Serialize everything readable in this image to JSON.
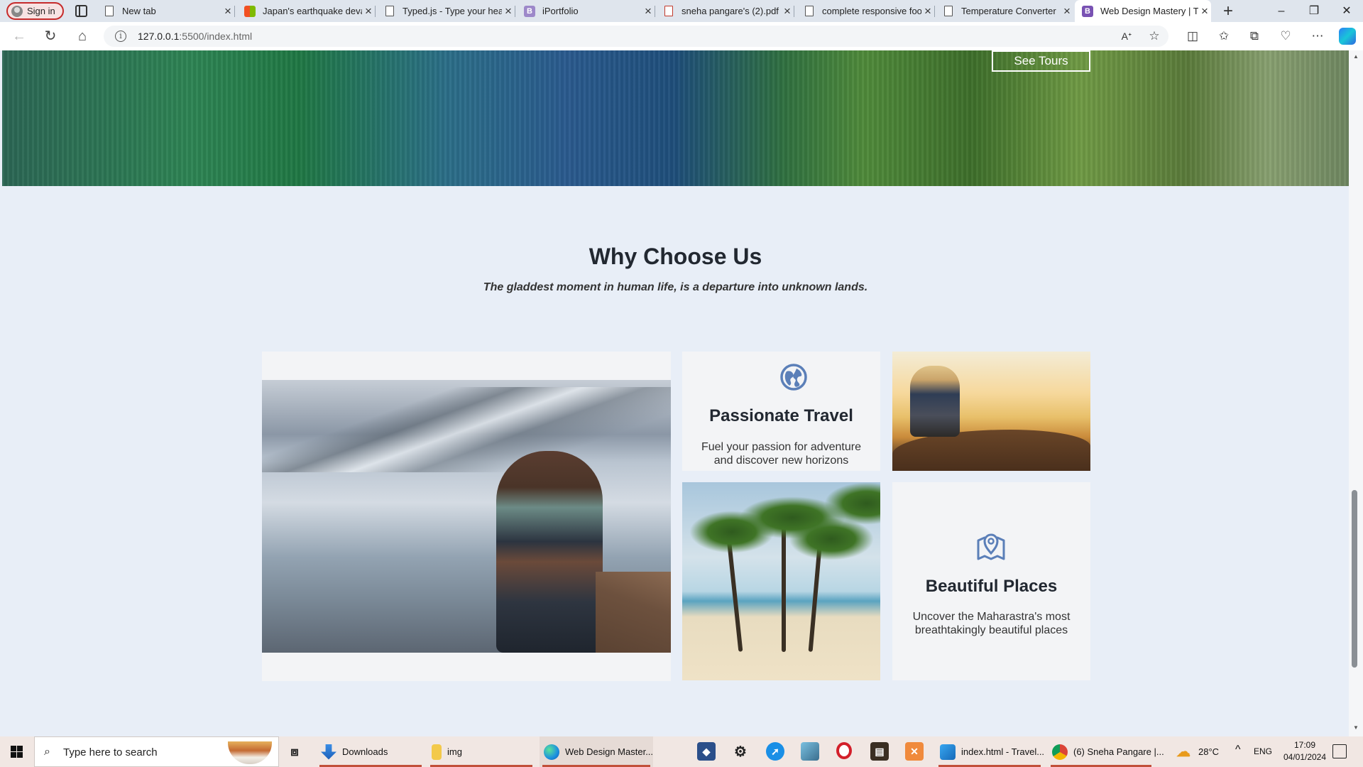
{
  "browser": {
    "signin_label": "Sign in",
    "tabs": [
      {
        "title": "New tab"
      },
      {
        "title": "Japan's earthquake deva"
      },
      {
        "title": "Typed.js - Type your hea"
      },
      {
        "title": "iPortfolio"
      },
      {
        "title": "sneha pangare's (2).pdf"
      },
      {
        "title": "complete responsive foo"
      },
      {
        "title": "Temperature Converter"
      },
      {
        "title": "Web Design Mastery | Tr"
      }
    ],
    "url_host": "127.0.0.1",
    "url_path": ":5500/index.html"
  },
  "page": {
    "hero_button": "See Tours",
    "section_title": "Why Choose Us",
    "section_subtitle": "The gladdest moment in human life, is a departure into unknown lands.",
    "cards": [
      {
        "title": "Passionate Travel",
        "text": "Fuel your passion for adventure and discover new horizons",
        "icon": "globe-icon"
      },
      {
        "title": "Beautiful Places",
        "text": "Uncover the Maharastra's most breathtakingly beautiful places",
        "icon": "map-pin-icon"
      }
    ],
    "accent_color": "#5b7fb8"
  },
  "taskbar": {
    "search_placeholder": "Type here to search",
    "apps": [
      {
        "label": "Downloads"
      },
      {
        "label": "img"
      },
      {
        "label": "Web Design Master..."
      },
      {
        "label": "index.html - Travel..."
      },
      {
        "label": "(6) Sneha Pangare |..."
      }
    ],
    "weather": "28°C",
    "lang": "ENG",
    "time": "17:09",
    "date": "04/01/2024"
  }
}
